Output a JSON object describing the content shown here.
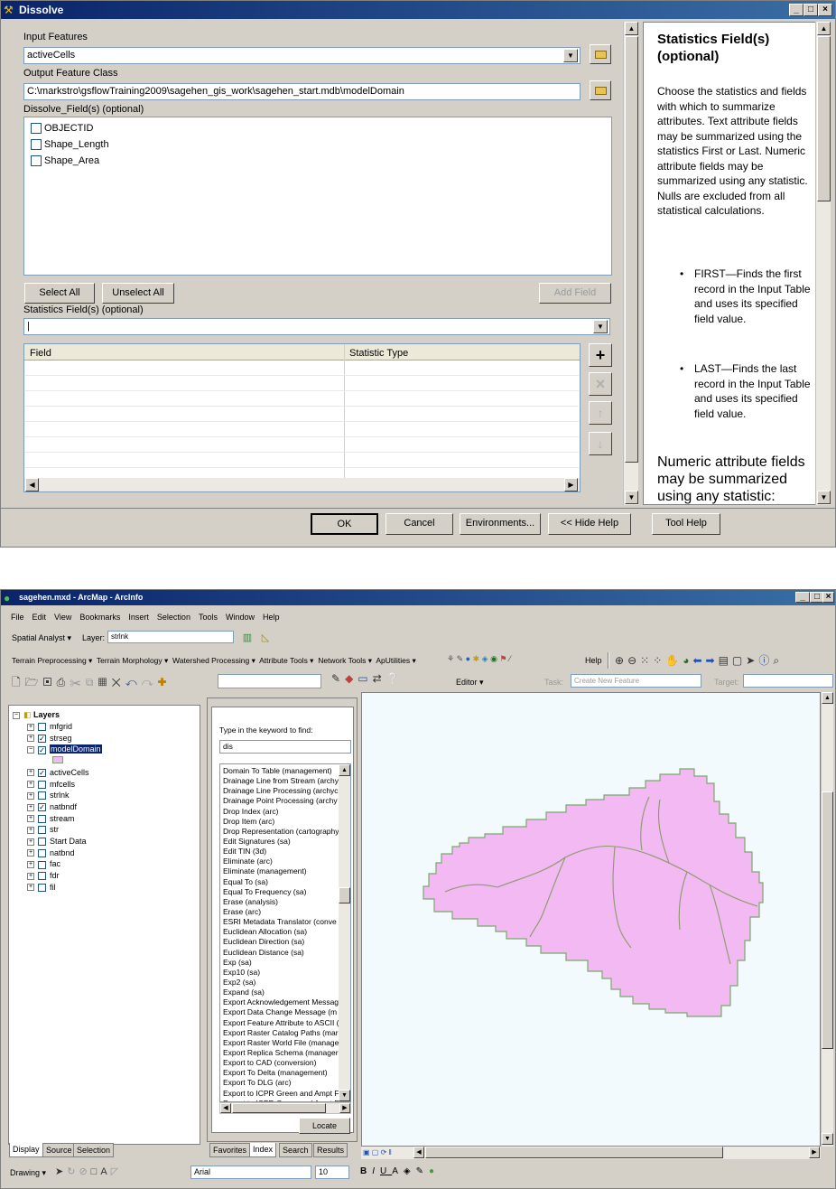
{
  "dissolve": {
    "title": "Dissolve",
    "input_features_label": "Input Features",
    "input_features_value": "activeCells",
    "output_class_label": "Output Feature Class",
    "output_class_value": "C:\\markstro\\gsflowTraining2009\\sagehen_gis_work\\sagehen_start.mdb\\modelDomain",
    "dissolve_fields_label": "Dissolve_Field(s) (optional)",
    "fields": [
      "OBJECTID",
      "Shape_Length",
      "Shape_Area"
    ],
    "select_all": "Select All",
    "unselect_all": "Unselect All",
    "add_field": "Add Field",
    "stats_label": "Statistics Field(s) (optional)",
    "stats_value": "|",
    "grid_headers": [
      "Field",
      "Statistic Type"
    ],
    "buttons": {
      "ok": "OK",
      "cancel": "Cancel",
      "environments": "Environments...",
      "hide_help": "<< Hide Help",
      "tool_help": "Tool Help"
    },
    "help": {
      "title": "Statistics Field(s) (optional)",
      "intro": "Choose the statistics and fields with which to summarize attributes. Text attribute fields may be summarized using the statistics First or Last. Numeric attribute fields may be summarized using any statistic. Nulls are excluded from all statistical calculations.",
      "first": "FIRST—Finds the first record in the Input Table and uses its specified field value.",
      "last": "LAST—Finds the last record in the Input Table and uses its specified field value.",
      "numeric": "Numeric attribute fields may be summarized using any statistic:"
    }
  },
  "arcmap": {
    "title": "sagehen.mxd - ArcMap - ArcInfo",
    "menu": [
      "File",
      "Edit",
      "View",
      "Bookmarks",
      "Insert",
      "Selection",
      "Tools",
      "Window",
      "Help"
    ],
    "spatial_analyst": "Spatial Analyst ▾",
    "layer_label": "Layer:",
    "layer_value": "strlnk",
    "toolbar2": [
      "Terrain Preprocessing ▾",
      "Terrain Morphology ▾",
      "Watershed Processing ▾",
      "Attribute Tools ▾",
      "Network Tools ▾",
      "ApUtilities ▾",
      "Help"
    ],
    "editor": "Editor ▾",
    "task_label": "Task:",
    "task_value": "Create New Feature",
    "target_label": "Target:",
    "toc_root": "Layers",
    "layers": [
      {
        "name": "mfgrid",
        "checked": false
      },
      {
        "name": "strseg",
        "checked": true
      },
      {
        "name": "modelDomain",
        "checked": true
      },
      {
        "name": "activeCells",
        "checked": true
      },
      {
        "name": "mfcells",
        "checked": false
      },
      {
        "name": "strlnk",
        "checked": false
      },
      {
        "name": "natbndf",
        "checked": true
      },
      {
        "name": "stream",
        "checked": false
      },
      {
        "name": "str",
        "checked": false
      },
      {
        "name": "Start Data",
        "checked": false
      },
      {
        "name": "natbnd",
        "checked": false
      },
      {
        "name": "fac",
        "checked": false
      },
      {
        "name": "fdr",
        "checked": false
      },
      {
        "name": "fil",
        "checked": false
      }
    ],
    "toc_tabs": [
      "Display",
      "Source",
      "Selection"
    ],
    "search_prompt": "Type in the keyword to find:",
    "search_value": "dis",
    "tools": [
      "Domain To Table (management)",
      "Drainage Line from Stream (archy",
      "Drainage Line Processing (archyc",
      "Drainage Point Processing (archy",
      "Drop Index (arc)",
      "Drop Item (arc)",
      "Drop Representation (cartography",
      "Edit Signatures (sa)",
      "Edit TIN (3d)",
      "Eliminate (arc)",
      "Eliminate (management)",
      "Equal To (sa)",
      "Equal To Frequency (sa)",
      "Erase (analysis)",
      "Erase (arc)",
      "ESRI Metadata Translator (conve",
      "Euclidean Allocation (sa)",
      "Euclidean Direction (sa)",
      "Euclidean Distance (sa)",
      "Exp (sa)",
      "Exp10 (sa)",
      "Exp2 (sa)",
      "Expand (sa)",
      "Export Acknowledgement Messag",
      "Export Data Change Message (m",
      "Export Feature Attribute to ASCII (",
      "Export Raster Catalog Paths (mar",
      "Export Raster World File (manage",
      "Export Replica Schema (manager",
      "Export to CAD (conversion)",
      "Export To Delta (management)",
      "Export To DLG (arc)",
      "Export to ICPR Green and Ampt F",
      "Export to ICPR Green and Ampt F"
    ],
    "locate": "Locate",
    "tool_tabs": [
      "Favorites",
      "Index",
      "Search",
      "Results"
    ],
    "drawing": "Drawing ▾",
    "font_name": "Arial",
    "font_size": "10",
    "colors": {
      "polygon_fill": "#f2b9f2",
      "polygon_outline": "#7aa86a",
      "stream": "#8a9a6a",
      "map_bg": "#f2fafd"
    }
  }
}
